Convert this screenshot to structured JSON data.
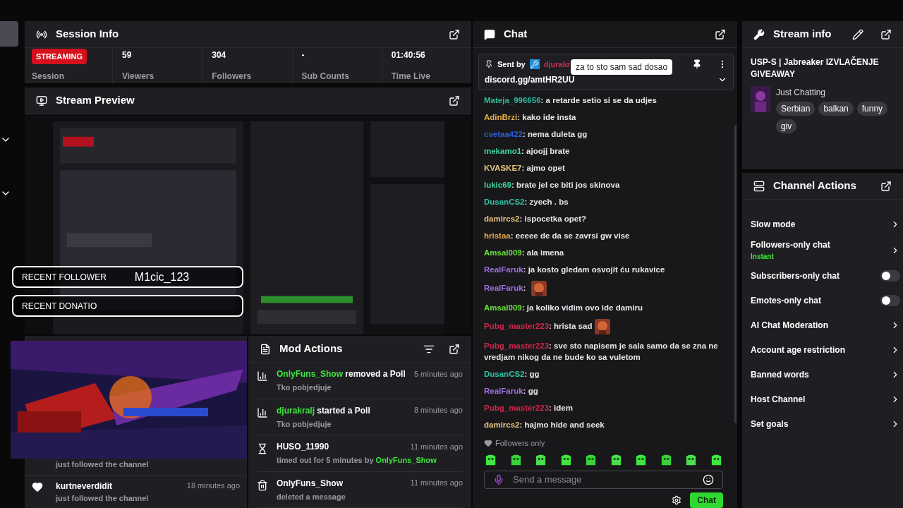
{
  "session_info": {
    "title": "Session Info",
    "badge": "STREAMING",
    "badge_label": "Session",
    "stats": [
      {
        "value": "59",
        "label": "Viewers"
      },
      {
        "value": "304",
        "label": "Followers"
      },
      {
        "value": "-",
        "label": "Sub Counts"
      },
      {
        "value": "01:40:56",
        "label": "Time Live"
      }
    ]
  },
  "stream_preview": {
    "title": "Stream Preview"
  },
  "overlays": [
    {
      "label": "RECENT FOLLOWER",
      "value": "M1cic_123"
    },
    {
      "label": "RECENT DONATIO"
    }
  ],
  "activity_feed": [
    {
      "detail": "just followed the channel"
    },
    {
      "user": "kurtneverdidit",
      "detail": "just followed the channel",
      "time": "18 minutes ago"
    }
  ],
  "mod_actions": {
    "title": "Mod Actions",
    "items": [
      {
        "kind": "poll",
        "user": "OnlyFuns_Show",
        "highlight": true,
        "action": "removed a Poll",
        "detail": "Tko pobjedjuje",
        "time": "5 minutes ago"
      },
      {
        "kind": "poll",
        "user": "djurakralj",
        "highlight": true,
        "action": "started a Poll",
        "detail": "Tko pobjedjuje",
        "time": "8 minutes ago"
      },
      {
        "kind": "timeout",
        "user": "HUSO_11990",
        "highlight": false,
        "detail": "timed out for 5 minutes by",
        "detail_user": "OnlyFuns_Show",
        "time": "11 minutes ago"
      },
      {
        "kind": "delete",
        "user": "OnlyFuns_Show",
        "highlight": false,
        "detail": "deleted a message",
        "time": "11 minutes ago"
      }
    ]
  },
  "chat": {
    "title": "Chat",
    "pinned": {
      "sent_by": "Sent by",
      "user": "djurakr",
      "message": "discord.gg/amtHR2UU",
      "tooltip": "za to sto sam sad dosao"
    },
    "messages": [
      {
        "user": "Mateja_996656",
        "color": "#2fb89a",
        "text": "a retarde setio si se da udjes"
      },
      {
        "user": "AdinBrzi",
        "color": "#e5b04a",
        "text": "kako ide insta"
      },
      {
        "user": "cvetaa422",
        "color": "#2e5fd8",
        "text": "nema duleta gg"
      },
      {
        "user": "mekamo1",
        "color": "#3ed6a0",
        "text": "ajoojj brate"
      },
      {
        "user": "KVASKE7",
        "color": "#e8c27a",
        "text": "ajmo opet"
      },
      {
        "user": "lukic69",
        "color": "#3ed6a0",
        "text": "brate jel ce biti jos skinova"
      },
      {
        "user": "DusanCS2",
        "color": "#2fc4a6",
        "text": "zyech . bs"
      },
      {
        "user": "damircs2",
        "color": "#e8c27a",
        "text": "ispocetka opet?"
      },
      {
        "user": "hristaa",
        "color": "#e5a84a",
        "text": "eeeee de da se zavrsi gw vise"
      },
      {
        "user": "Amsal009",
        "color": "#6be03c",
        "text": "ala imena"
      },
      {
        "user": "RealFaruk",
        "color": "#a070e0",
        "text": "ja kosto gledam osvojit ću rukavice"
      },
      {
        "user": "RealFaruk",
        "color": "#a070e0",
        "emote": true
      },
      {
        "user": "Amsal009",
        "color": "#6be03c",
        "text": "ja koliko vidim ovo ide damiru"
      },
      {
        "user": "Pubg_master223",
        "color": "#d0284a",
        "text": "hrista sad",
        "emote": true
      },
      {
        "user": "Pubg_master223",
        "color": "#d0284a",
        "text": "sve sto napisem je sala samo da se zna ne vredjam nikog da ne bude ko sa vuletom"
      },
      {
        "user": "DusanCS2",
        "color": "#2fc4a6",
        "text": "gg"
      },
      {
        "user": "RealFaruk",
        "color": "#a070e0",
        "text": "gg"
      },
      {
        "user": "Pubg_master223",
        "color": "#d0284a",
        "text": "idem"
      },
      {
        "user": "damircs2",
        "color": "#e8c27a",
        "text": "hajmo hide and seek"
      }
    ],
    "separator": ":",
    "followers_only": "Followers only",
    "input": {
      "placeholder": "Send a message"
    },
    "send": "Chat"
  },
  "stream_info": {
    "title": "Stream info",
    "stream_title": "USP-S | Jabreaker IZVLAČENJE GIVEAWAY",
    "category": "Just Chatting",
    "tags": [
      "Serbian",
      "balkan",
      "funny",
      "giv"
    ]
  },
  "channel_actions": {
    "title": "Channel Actions",
    "items": [
      {
        "kind": "link",
        "label": "Slow mode"
      },
      {
        "kind": "link",
        "label": "Followers-only chat",
        "sub": "Instant"
      },
      {
        "kind": "toggle",
        "label": "Subscribers-only chat",
        "on": false
      },
      {
        "kind": "toggle",
        "label": "Emotes-only chat",
        "on": false
      },
      {
        "kind": "link",
        "label": "AI Chat Moderation"
      },
      {
        "kind": "link",
        "label": "Account age restriction"
      },
      {
        "kind": "link",
        "label": "Banned words"
      },
      {
        "kind": "link",
        "label": "Host Channel"
      },
      {
        "kind": "link",
        "label": "Set goals"
      }
    ]
  }
}
